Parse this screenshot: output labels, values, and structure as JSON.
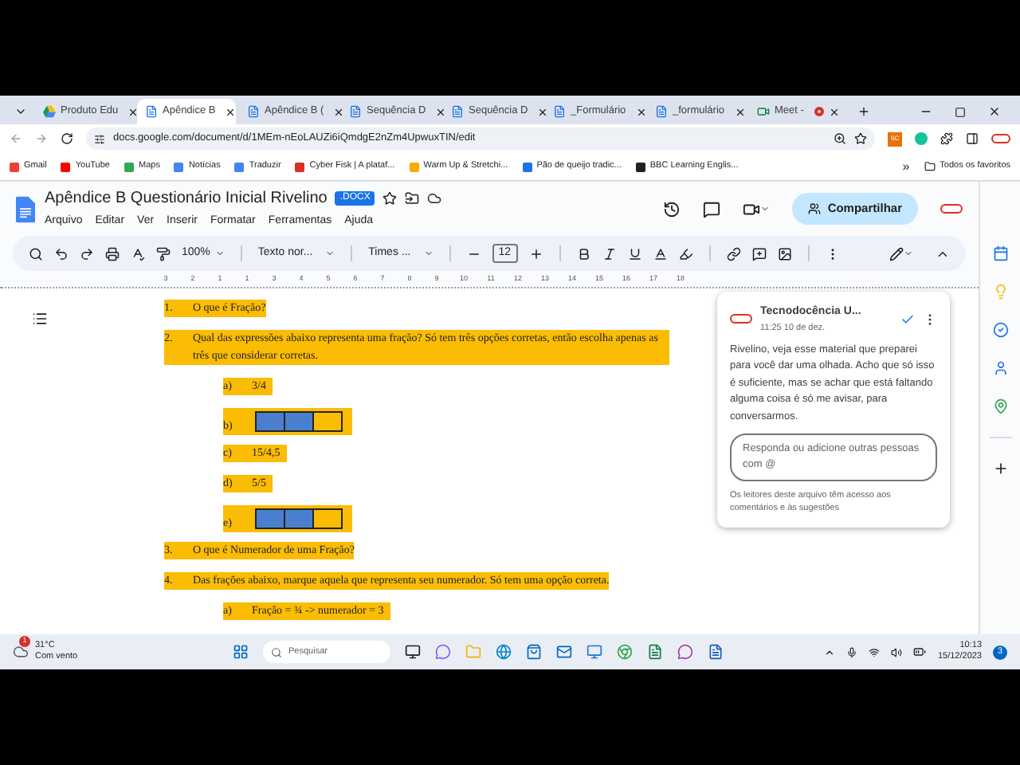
{
  "browser": {
    "tabs": [
      {
        "title": "Produto Edu",
        "kind": "drive",
        "selected": false,
        "recording": false
      },
      {
        "title": "Apêndice B",
        "kind": "docs",
        "selected": true,
        "recording": false
      },
      {
        "title": "Apêndice B (",
        "kind": "docs",
        "selected": false,
        "recording": false
      },
      {
        "title": "Sequência D",
        "kind": "docs",
        "selected": false,
        "recording": false
      },
      {
        "title": "Sequência D",
        "kind": "docs",
        "selected": false,
        "recording": false
      },
      {
        "title": "_Formulário",
        "kind": "docs",
        "selected": false,
        "recording": false
      },
      {
        "title": "_formulário",
        "kind": "docs",
        "selected": false,
        "recording": false
      },
      {
        "title": "Meet - ",
        "kind": "meet",
        "selected": false,
        "recording": true
      }
    ],
    "address": "docs.google.com/document/d/1MEm-nEoLAUZi6iQmdgE2nZm4UpwuxTIN/edit",
    "extension_label": "SC",
    "bookmarks": [
      {
        "label": "Gmail",
        "color": "#ea4335"
      },
      {
        "label": "YouTube",
        "color": "#ff0000"
      },
      {
        "label": "Maps",
        "color": "#34a853"
      },
      {
        "label": "Notícias",
        "color": "#4285f4"
      },
      {
        "label": "Traduzir",
        "color": "#4285f4"
      },
      {
        "label": "Cyber Fisk | A plataf...",
        "color": "#d93025"
      },
      {
        "label": "Warm Up & Stretchi...",
        "color": "#f9ab00"
      },
      {
        "label": "Pão de queijo tradic...",
        "color": "#1a73e8"
      },
      {
        "label": "BBC Learning Englis...",
        "color": "#202124"
      }
    ],
    "more_bookmarks": "»",
    "all_bookmarks": "Todos os favoritos"
  },
  "document": {
    "title": "Apêndice B Questionário Inicial Rivelino",
    "badge": ".DOCX",
    "menus": [
      "Arquivo",
      "Editar",
      "Ver",
      "Inserir",
      "Formatar",
      "Ferramentas",
      "Ajuda"
    ],
    "share": "Compartilhar",
    "toolbar": {
      "zoom": "100%",
      "style": "Texto nor...",
      "font": "Times ...",
      "size": "12"
    },
    "ruler": [
      "3",
      "2",
      "1",
      "1",
      "3",
      "4",
      "5",
      "6",
      "7",
      "8",
      "9",
      "10",
      "11",
      "12",
      "13",
      "14",
      "15",
      "16",
      "17",
      "18"
    ]
  },
  "content": [
    {
      "kind": "question",
      "number": "1.",
      "text": "O que é Fração?"
    },
    {
      "kind": "question",
      "number": "2.",
      "text": "Qual das expressões abaixo representa uma fração? Só tem três opções corretas, então escolha apenas as três que considerar corretas."
    },
    {
      "kind": "option",
      "letter": "a)",
      "text": "3/4"
    },
    {
      "kind": "bar",
      "letter": "b)",
      "cells": [
        {
          "filled": true
        },
        {
          "filled": true
        },
        {
          "filled": false
        }
      ]
    },
    {
      "kind": "option",
      "letter": "c)",
      "text": "15/4,5"
    },
    {
      "kind": "option",
      "letter": "d)",
      "text": "5/5"
    },
    {
      "kind": "bar",
      "letter": "e)",
      "cells": [
        {
          "filled": true
        },
        {
          "filled": true
        },
        {
          "filled": false
        }
      ]
    },
    {
      "kind": "question",
      "number": "3.",
      "text": "O que é Numerador de uma Fração?"
    },
    {
      "kind": "question",
      "number": "4.",
      "text": "Das frações abaixo, marque aquela que representa seu numerador. Só tem uma opção correta."
    },
    {
      "kind": "option",
      "letter": "a)",
      "text": "Fração = ¾ -> numerador = 3"
    }
  ],
  "comment": {
    "author": "Tecnodocência U...",
    "time": "11:25 10 de dez.",
    "resolved": true,
    "body": "Rivelino, veja esse material que preparei para você dar uma olhada. Acho que só isso é suficiente, mas se achar que está faltando alguma coisa é só me avisar, para conversarmos.",
    "reply_placeholder": "Responda ou adicione outras pessoas com @",
    "note": "Os leitores deste arquivo têm acesso aos comentários e às sugestões"
  },
  "taskbar": {
    "temperature": "31°C",
    "weather": "Com vento",
    "weather_badge": "1",
    "search_placeholder": "Pesquisar",
    "time": "10:13",
    "date": "15/12/2023",
    "notifications": "3"
  }
}
